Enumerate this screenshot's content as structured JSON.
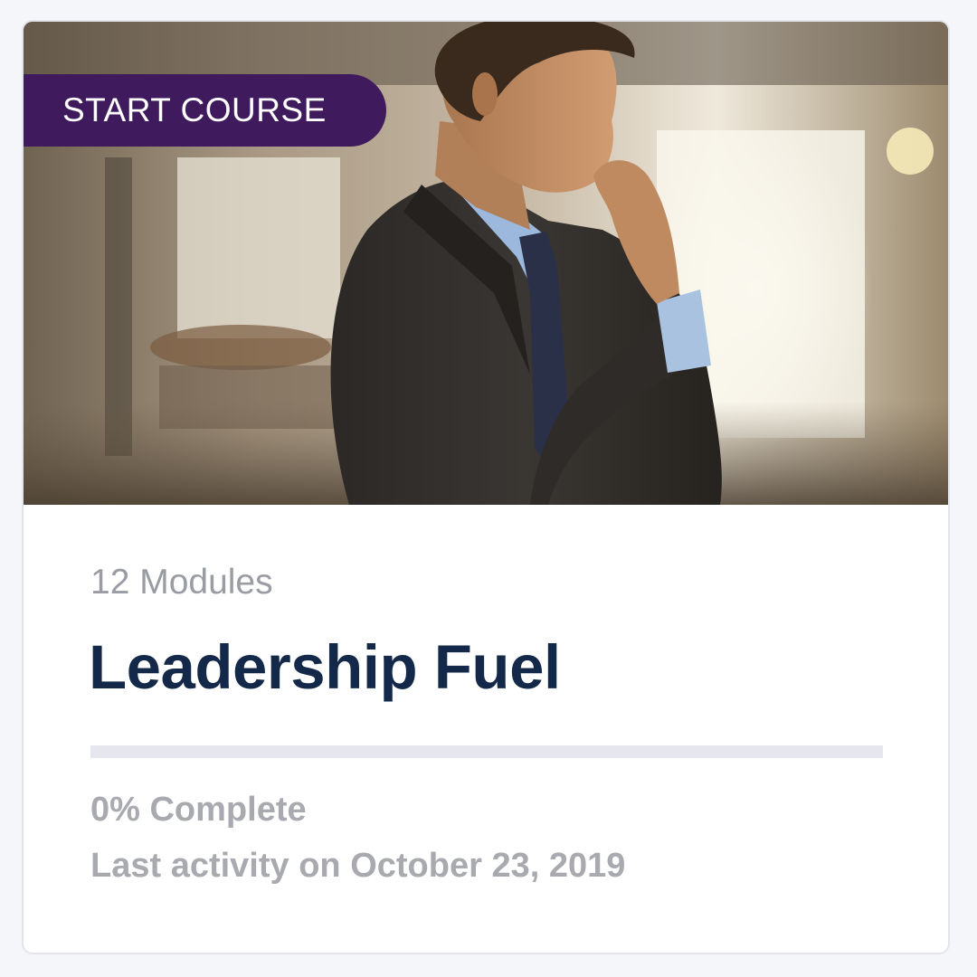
{
  "course": {
    "badge_label": "START COURSE",
    "modules_text": "12 Modules",
    "title": "Leadership Fuel",
    "progress_fraction": 0,
    "complete_text": "0% Complete",
    "last_activity_text": "Last activity on October 23, 2019",
    "image_subject": "businessman-thinking-photo"
  },
  "colors": {
    "badge": "#3f1a5c",
    "title": "#14294a",
    "muted_text": "#a8aab0",
    "progress_track": "#e6e6ee",
    "card_border": "#e3e5ea"
  }
}
